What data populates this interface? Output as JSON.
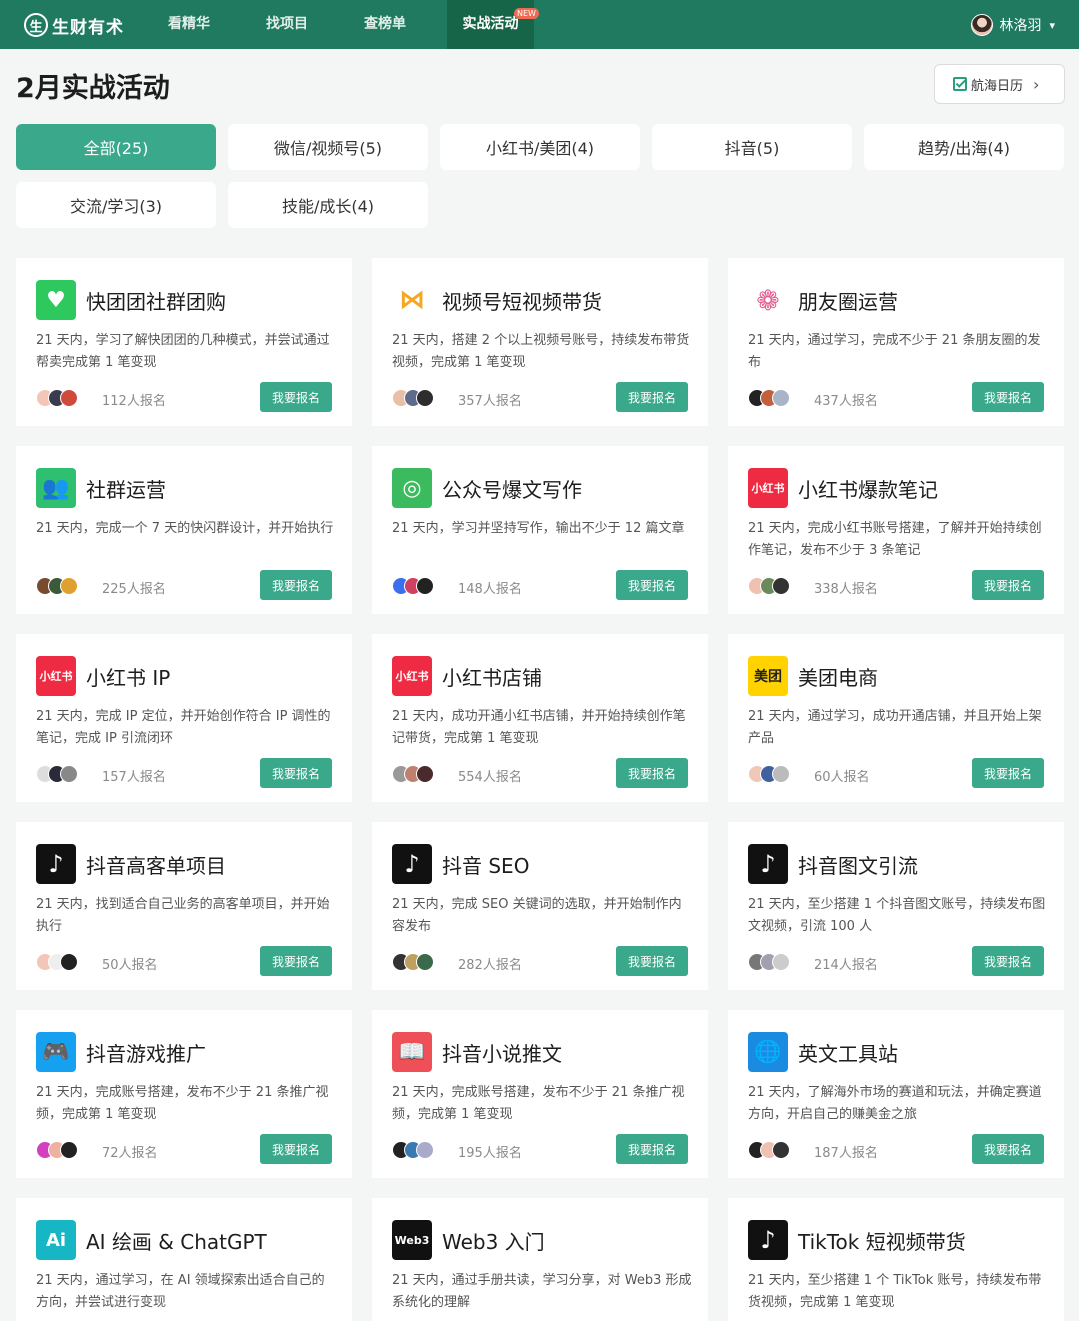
{
  "header": {
    "logo_mark": "生",
    "logo_text": "生财有术",
    "nav": [
      {
        "label": "看精华"
      },
      {
        "label": "找项目"
      },
      {
        "label": "查榜单"
      },
      {
        "label": "实战活动",
        "badge": "NEW"
      }
    ],
    "user_name": "林洛羽"
  },
  "page": {
    "title": "2月实战活动",
    "calendar_label": "航海日历"
  },
  "filters": [
    {
      "label": "全部(25)",
      "active": true
    },
    {
      "label": "微信/视频号(5)"
    },
    {
      "label": "小红书/美团(4)"
    },
    {
      "label": "抖音(5)"
    },
    {
      "label": "趋势/出海(4)"
    },
    {
      "label": "交流/学习(3)"
    },
    {
      "label": "技能/成长(4)"
    }
  ],
  "signup_label": "我要报名",
  "cards": [
    {
      "title": "快团团社群团购",
      "desc": "21 天内，学习了解快团团的几种模式，并尝试通过帮卖完成第 1 笔变现",
      "count": "112人报名",
      "icon": "kuaituantuan-icon",
      "icon_text": "♥"
    },
    {
      "title": "视频号短视频带货",
      "desc": "21 天内，搭建 2 个以上视频号账号，持续发布带货视频，完成第 1 笔变现",
      "count": "357人报名",
      "icon": "channels-icon",
      "icon_text": "⋈"
    },
    {
      "title": "朋友圈运营",
      "desc": "21 天内，通过学习，完成不少于 21 条朋友圈的发布",
      "count": "437人报名",
      "icon": "moments-icon",
      "icon_text": "❁"
    },
    {
      "title": "社群运营",
      "desc": "21 天内，完成一个 7 天的快闪群设计，并开始执行",
      "count": "225人报名",
      "icon": "community-icon",
      "icon_text": "👥"
    },
    {
      "title": "公众号爆文写作",
      "desc": "21 天内，学习并坚持写作，输出不少于 12 篇文章",
      "count": "148人报名",
      "icon": "official-account-icon",
      "icon_text": "◎"
    },
    {
      "title": "小红书爆款笔记",
      "desc": "21 天内，完成小红书账号搭建，了解并开始持续创作笔记，发布不少于 3 条笔记",
      "count": "338人报名",
      "icon": "xiaohongshu-icon",
      "icon_text": "小红书"
    },
    {
      "title": "小红书 IP",
      "desc": "21 天内，完成 IP 定位，并开始创作符合 IP 调性的笔记，完成 IP 引流闭环",
      "count": "157人报名",
      "icon": "xiaohongshu-icon",
      "icon_text": "小红书"
    },
    {
      "title": "小红书店铺",
      "desc": "21 天内，成功开通小红书店铺，并开始持续创作笔记带货，完成第 1 笔变现",
      "count": "554人报名",
      "icon": "xiaohongshu-icon",
      "icon_text": "小红书"
    },
    {
      "title": "美团电商",
      "desc": "21 天内，通过学习，成功开通店铺，并且开始上架产品",
      "count": "60人报名",
      "icon": "meituan-icon",
      "icon_text": "美团"
    },
    {
      "title": "抖音高客单项目",
      "desc": "21 天内，找到适合自己业务的高客单项目，并开始执行",
      "count": "50人报名",
      "icon": "douyin-icon",
      "icon_text": "♪"
    },
    {
      "title": "抖音 SEO",
      "desc": "21 天内，完成 SEO 关键词的选取，并开始制作内容发布",
      "count": "282人报名",
      "icon": "douyin-icon",
      "icon_text": "♪"
    },
    {
      "title": "抖音图文引流",
      "desc": "21 天内，至少搭建 1 个抖音图文账号，持续发布图文视频，引流 100 人",
      "count": "214人报名",
      "icon": "douyin-icon",
      "icon_text": "♪"
    },
    {
      "title": "抖音游戏推广",
      "desc": "21 天内，完成账号搭建，发布不少于 21 条推广视频，完成第 1 笔变现",
      "count": "72人报名",
      "icon": "gamepad-icon",
      "icon_text": "🎮"
    },
    {
      "title": "抖音小说推文",
      "desc": "21 天内，完成账号搭建，发布不少于 21 条推广视频，完成第 1 笔变现",
      "count": "195人报名",
      "icon": "book-icon",
      "icon_text": "📖"
    },
    {
      "title": "英文工具站",
      "desc": "21 天内，了解海外市场的赛道和玩法，并确定赛道方向，开启自己的赚美金之旅",
      "count": "187人报名",
      "icon": "globe-icon",
      "icon_text": "🌐"
    },
    {
      "title": "AI 绘画 & ChatGPT",
      "desc": "21 天内，通过学习，在 AI 领域探索出适合自己的方向，并尝试进行变现",
      "count": "",
      "icon": "ai-icon",
      "icon_text": "Ai"
    },
    {
      "title": "Web3 入门",
      "desc": "21 天内，通过手册共读，学习分享，对 Web3 形成系统化的理解",
      "count": "",
      "icon": "web3-icon",
      "icon_text": "Web3"
    },
    {
      "title": "TikTok 短视频带货",
      "desc": "21 天内，至少搭建 1 个 TikTok 账号，持续发布带货视频，完成第 1 笔变现",
      "count": "",
      "icon": "tiktok-icon",
      "icon_text": "♪"
    }
  ],
  "colors": {
    "header": "#1f7a60",
    "accent": "#3aa88a",
    "background": "#f4f5f5"
  }
}
